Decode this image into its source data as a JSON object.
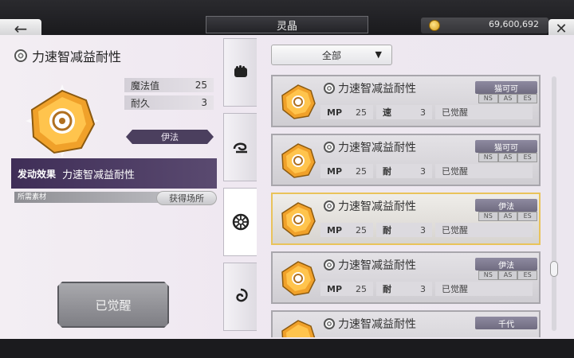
{
  "header": {
    "title": "灵晶",
    "coins": "69,600,692",
    "back_icon": "back-arrow-icon",
    "close_icon": "close-icon"
  },
  "detail": {
    "name": "力速智减益耐性",
    "stats": [
      {
        "label": "魔法值",
        "value": "25"
      },
      {
        "label": "耐久",
        "value": "3"
      }
    ],
    "owner_tag": "伊法",
    "effect_label": "发动效果",
    "effect_value": "力速智减益耐性",
    "material_label": "所需素材",
    "obtain_button": "获得场所",
    "awakened_button": "已觉醒"
  },
  "tabs": [
    {
      "icon": "fist-icon"
    },
    {
      "icon": "swirl-icon"
    },
    {
      "icon": "rune-icon"
    },
    {
      "icon": "vortex-icon"
    }
  ],
  "filter": {
    "selected": "全部"
  },
  "list": [
    {
      "name": "力速智减益耐性",
      "owner": "猫可可",
      "slots": [
        "NS",
        "AS",
        "ES"
      ],
      "mp_label": "MP",
      "mp": "25",
      "stat_label": "速",
      "stat": "3",
      "status": "已觉醒",
      "selected": false
    },
    {
      "name": "力速智减益耐性",
      "owner": "猫可可",
      "slots": [
        "NS",
        "AS",
        "ES"
      ],
      "mp_label": "MP",
      "mp": "25",
      "stat_label": "耐",
      "stat": "3",
      "status": "已觉醒",
      "selected": false
    },
    {
      "name": "力速智减益耐性",
      "owner": "伊法",
      "slots": [
        "NS",
        "AS",
        "ES"
      ],
      "mp_label": "MP",
      "mp": "25",
      "stat_label": "耐",
      "stat": "3",
      "status": "已觉醒",
      "selected": true
    },
    {
      "name": "力速智减益耐性",
      "owner": "伊法",
      "slots": [
        "NS",
        "AS",
        "ES"
      ],
      "mp_label": "MP",
      "mp": "25",
      "stat_label": "耐",
      "stat": "3",
      "status": "已觉醒",
      "selected": false
    },
    {
      "name": "力速智减益耐性",
      "owner": "千代",
      "slots": [],
      "mp_label": "",
      "mp": "",
      "stat_label": "",
      "stat": "",
      "status": "",
      "selected": false
    }
  ]
}
